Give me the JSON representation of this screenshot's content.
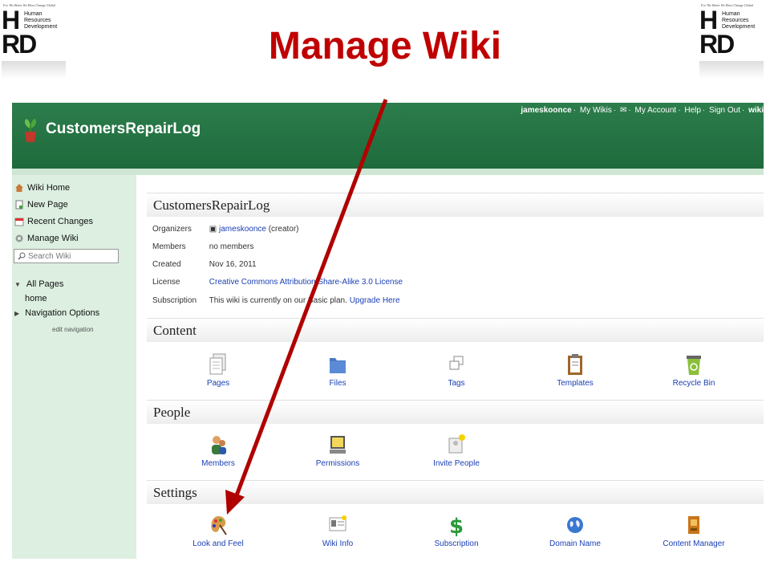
{
  "slide": {
    "title": "Manage Wiki"
  },
  "logo": {
    "tagline": "For The Better We Move Change Global",
    "letters_top": "H",
    "letters_bottom": "RD",
    "line1": "Human",
    "line2": "Resources",
    "line3": "Development"
  },
  "topbar": {
    "wiki_name": "CustomersRepairLog",
    "user": "jameskoonce",
    "links": [
      "My Wikis",
      "My Account",
      "Help",
      "Sign Out"
    ],
    "brand": "wiki"
  },
  "sidebar": {
    "items": [
      {
        "label": "Wiki Home",
        "icon": "house-icon"
      },
      {
        "label": "New Page",
        "icon": "new-page-icon"
      },
      {
        "label": "Recent Changes",
        "icon": "calendar-icon"
      },
      {
        "label": "Manage Wiki",
        "icon": "gear-icon"
      }
    ],
    "search_placeholder": "Search Wiki",
    "all_pages": "All Pages",
    "home": "home",
    "nav_options": "Navigation Options",
    "edit_nav": "edit navigation"
  },
  "wiki_info": {
    "heading": "CustomersRepairLog",
    "organizers_label": "Organizers",
    "organizer_link": "jameskoonce",
    "organizer_role": "(creator)",
    "members_label": "Members",
    "members_value": "no members",
    "created_label": "Created",
    "created_value": "Nov 16, 2011",
    "license_label": "License",
    "license_value": "Creative Commons Attribution Share-Alike 3.0 License",
    "subscription_label": "Subscription",
    "subscription_text": "This wiki is currently on our Basic plan.",
    "upgrade_link": "Upgrade Here"
  },
  "content": {
    "heading": "Content",
    "items": [
      "Pages",
      "Files",
      "Tags",
      "Templates",
      "Recycle Bin"
    ]
  },
  "people": {
    "heading": "People",
    "items": [
      "Members",
      "Permissions",
      "Invite People"
    ]
  },
  "settings": {
    "heading": "Settings",
    "items": [
      "Look and Feel",
      "Wiki Info",
      "Subscription",
      "Domain Name",
      "Content Manager"
    ]
  },
  "colors": {
    "title_red": "#c00000",
    "arrow_red": "#b00000",
    "topbar_green": "#1e6a3c",
    "sidebar_green": "#dcefe0",
    "link_blue": "#1a3fb4"
  }
}
